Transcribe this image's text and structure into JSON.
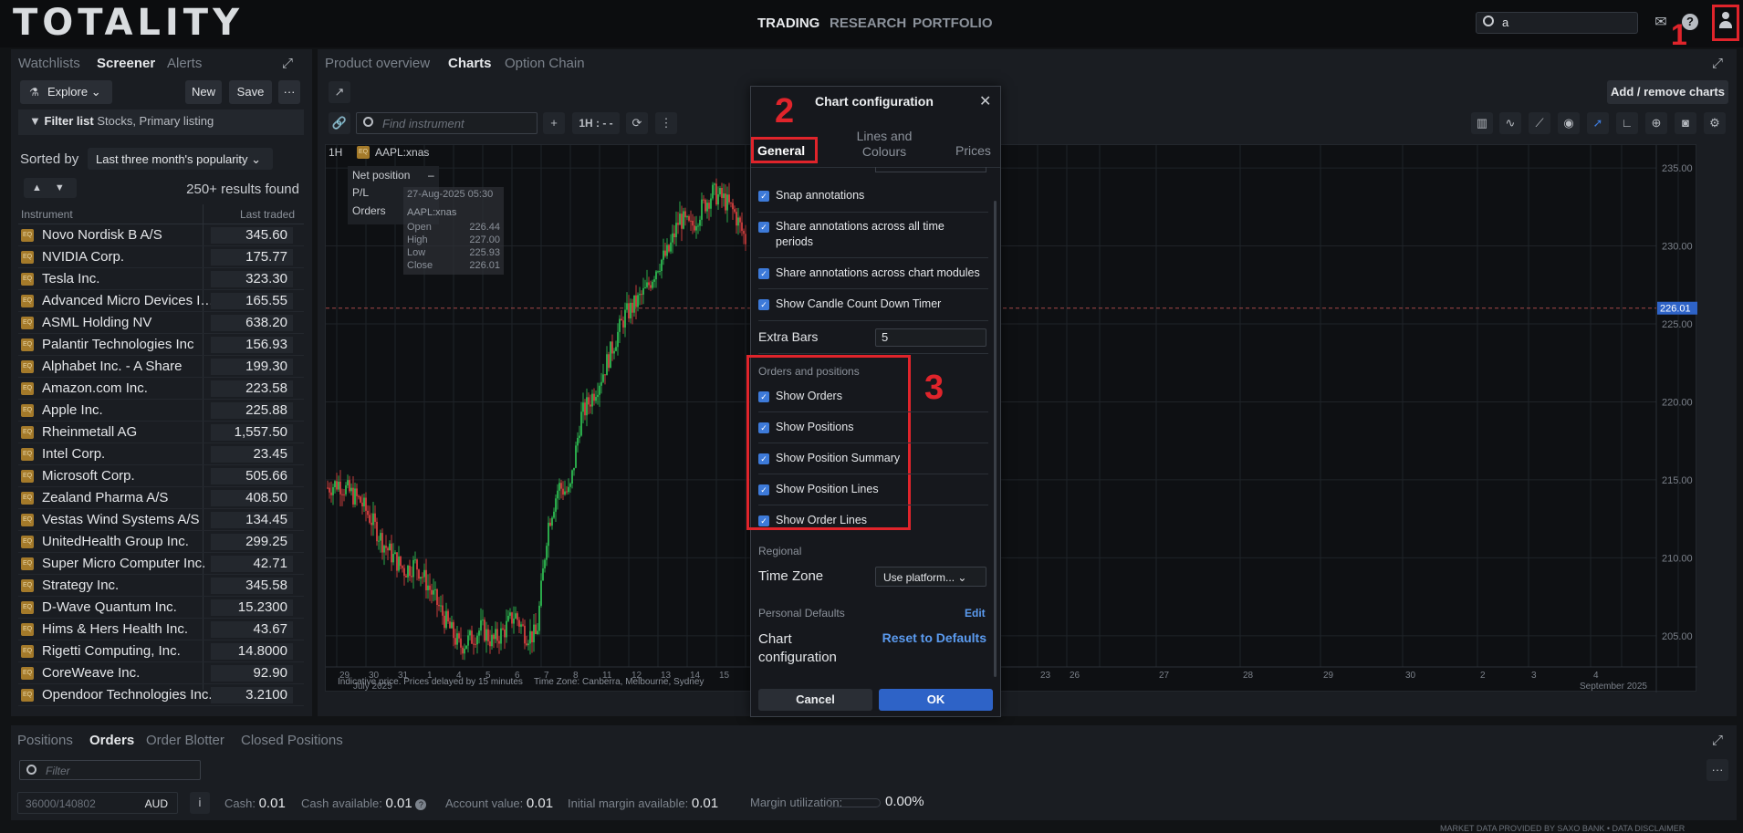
{
  "app": {
    "logo": "TOTALITY",
    "nav": [
      "TRADING",
      "RESEARCH",
      "PORTFOLIO"
    ],
    "search_value": "a"
  },
  "annotations": {
    "n1": "1",
    "n2": "2",
    "n3": "3"
  },
  "left": {
    "tabs": [
      "Watchlists",
      "Screener",
      "Alerts"
    ],
    "explore": "Explore",
    "new": "New",
    "save": "Save",
    "more": "···",
    "filter_label": "Filter list",
    "filter_value": "Stocks, Primary listing",
    "sorted_by": "Sorted by",
    "sort_value": "Last three month's popularity",
    "results": "250+ results found",
    "col_instrument": "Instrument",
    "col_last": "Last traded",
    "eq": "EQ",
    "rows": [
      [
        "Novo Nordisk B A/S",
        "345.60"
      ],
      [
        "NVIDIA Corp.",
        "175.77"
      ],
      [
        "Tesla Inc.",
        "323.30"
      ],
      [
        "Advanced Micro Devices Inc.",
        "165.55"
      ],
      [
        "ASML Holding NV",
        "638.20"
      ],
      [
        "Palantir Technologies Inc",
        "156.93"
      ],
      [
        "Alphabet Inc. - A Share",
        "199.30"
      ],
      [
        "Amazon.com Inc.",
        "223.58"
      ],
      [
        "Apple Inc.",
        "225.88"
      ],
      [
        "Rheinmetall AG",
        "1,557.50"
      ],
      [
        "Intel Corp.",
        "23.45"
      ],
      [
        "Microsoft Corp.",
        "505.66"
      ],
      [
        "Zealand Pharma A/S",
        "408.50"
      ],
      [
        "Vestas Wind Systems A/S",
        "134.45"
      ],
      [
        "UnitedHealth Group Inc.",
        "299.25"
      ],
      [
        "Super Micro Computer Inc.",
        "42.71"
      ],
      [
        "Strategy Inc.",
        "345.58"
      ],
      [
        "D-Wave Quantum Inc.",
        "15.2300"
      ],
      [
        "Hims & Hers Health Inc.",
        "43.67"
      ],
      [
        "Rigetti Computing, Inc.",
        "14.8000"
      ],
      [
        "CoreWeave Inc.",
        "92.90"
      ],
      [
        "Opendoor Technologies Inc.",
        "3.2100"
      ]
    ]
  },
  "main": {
    "tabs": [
      "Product overview",
      "Charts",
      "Option Chain"
    ],
    "add_remove": "Add / remove charts",
    "find_placeholder": "Find instrument",
    "interval": "1H : - -",
    "chart_interval": "1H",
    "symbol": "AAPL:xnas",
    "net_position": "Net position",
    "pl": "P/L",
    "orders": "Orders",
    "dash": "–",
    "ohlc_date": "27-Aug-2025 05:30",
    "ohlc_sym": "AAPL:xnas",
    "ohlc": [
      [
        "Open",
        "226.44"
      ],
      [
        "High",
        "227.00"
      ],
      [
        "Low",
        "225.93"
      ],
      [
        "Close",
        "226.01"
      ]
    ],
    "y_ticks": [
      "235.00",
      "230.00",
      "225.00",
      "220.00",
      "215.00",
      "210.00",
      "205.00"
    ],
    "last_price": "226.01",
    "x_ticks": [
      "29",
      "30",
      "31",
      "1",
      "4",
      "5",
      "6",
      "7",
      "8",
      "11",
      "12",
      "13",
      "14",
      "15",
      "23",
      "26",
      "27",
      "28",
      "29",
      "30",
      "2",
      "3",
      "4"
    ],
    "months": [
      "July 2025",
      "September 2025"
    ],
    "footnote": "Indicative price. Prices delayed by 15 minutes",
    "tz_note": "Time Zone: Canberra, Melbourne, Sydney"
  },
  "modal": {
    "title": "Chart configuration",
    "tabs": [
      "General",
      "Lines and Colours",
      "Prices"
    ],
    "items_top": [
      "Snap annotations",
      "Share annotations across all time periods",
      "Share annotations across chart modules",
      "Show Candle Count Down Timer"
    ],
    "extra_bars_label": "Extra Bars",
    "extra_bars": "5",
    "orders_section": "Orders and positions",
    "items_orders": [
      "Show Orders",
      "Show Positions",
      "Show Position Summary",
      "Show Position Lines",
      "Show Order Lines"
    ],
    "regional": "Regional",
    "tz_label": "Time Zone",
    "tz_value": "Use platform...",
    "personal": "Personal Defaults",
    "edit": "Edit",
    "chart_config": "Chart configuration",
    "reset": "Reset to Defaults",
    "cancel": "Cancel",
    "ok": "OK"
  },
  "bottom": {
    "tabs": [
      "Positions",
      "Orders",
      "Order Blotter",
      "Closed Positions"
    ],
    "filter_placeholder": "Filter",
    "account": "36000/140802",
    "currency": "AUD",
    "cash_label": "Cash:",
    "cash": "0.01",
    "cash_avail_label": "Cash available:",
    "cash_avail": "0.01",
    "acct_label": "Account value:",
    "acct": "0.01",
    "im_label": "Initial margin available:",
    "im": "0.01",
    "mu_label": "Margin utilization:",
    "mu": "0.00%",
    "footer": "MARKET DATA PROVIDED BY SAXO BANK • DATA DISCLAIMER"
  },
  "chart_data": {
    "type": "candlestick",
    "symbol": "AAPL:xnas",
    "interval": "1H",
    "ylim": [
      203,
      236
    ],
    "last": 226.01,
    "path": [
      214.5,
      214.8,
      214.2,
      213.6,
      212.4,
      211.0,
      210.0,
      209.2,
      209.6,
      208.4,
      207.0,
      205.6,
      204.3,
      204.8,
      205.5,
      204.6,
      205.3,
      206.4,
      205.1,
      205.0,
      212.0,
      214.6,
      214.1,
      219.0,
      220.3,
      221.8,
      223.7,
      225.5,
      226.3,
      227.2,
      228.8,
      229.6,
      231.8,
      231.1,
      232.4,
      233.4,
      233.0,
      232.1,
      230.4
    ]
  }
}
